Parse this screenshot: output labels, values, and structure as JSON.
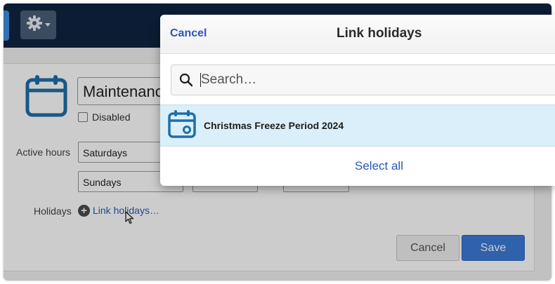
{
  "form": {
    "name_value": "Maintenance",
    "disabled_label": "Disabled",
    "active_hours_label": "Active hours",
    "day_rows": [
      "Saturdays",
      "Sundays"
    ],
    "holidays_label": "Holidays",
    "link_holidays": "Link holidays…",
    "cancel_label": "Cancel",
    "save_label": "Save"
  },
  "modal": {
    "cancel_label": "Cancel",
    "title": "Link holidays",
    "search_placeholder": "Search…",
    "holidays": [
      {
        "name": "Christmas Freeze Period 2024",
        "icon": "calendar-icon"
      }
    ],
    "select_all_label": "Select all"
  },
  "colors": {
    "topbar": "#0f2340",
    "accent_blue": "#2a58b8",
    "primary_button": "#3d7ad9",
    "icon_blue": "#1f6fa8",
    "highlight_row": "#dbeffb"
  }
}
